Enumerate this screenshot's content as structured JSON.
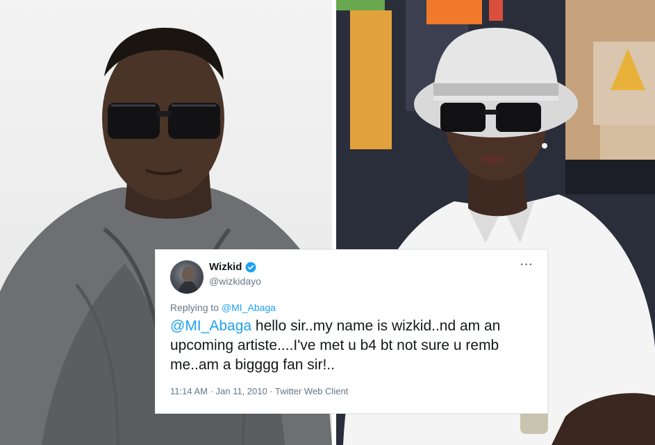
{
  "tweet": {
    "display_name": "Wizkid",
    "handle": "@wizkidayo",
    "more_label": "···",
    "replying_prefix": "Replying to ",
    "replying_to": "@MI_Abaga",
    "text_mention": "@MI_Abaga",
    "text_body": " hello sir..my name is wizkid..nd am an upcoming artiste....I've met u b4 bt not sure u remb me..am a bigggg fan sir!..",
    "timestamp": "11:14 AM · Jan 11, 2010 · Twitter Web Client"
  },
  "colors": {
    "link": "#1da1f2",
    "text": "#14171a",
    "muted": "#657786",
    "verified": "#1da1f2"
  },
  "icons": {
    "verified": "verified-badge-icon",
    "avatar": "avatar"
  }
}
